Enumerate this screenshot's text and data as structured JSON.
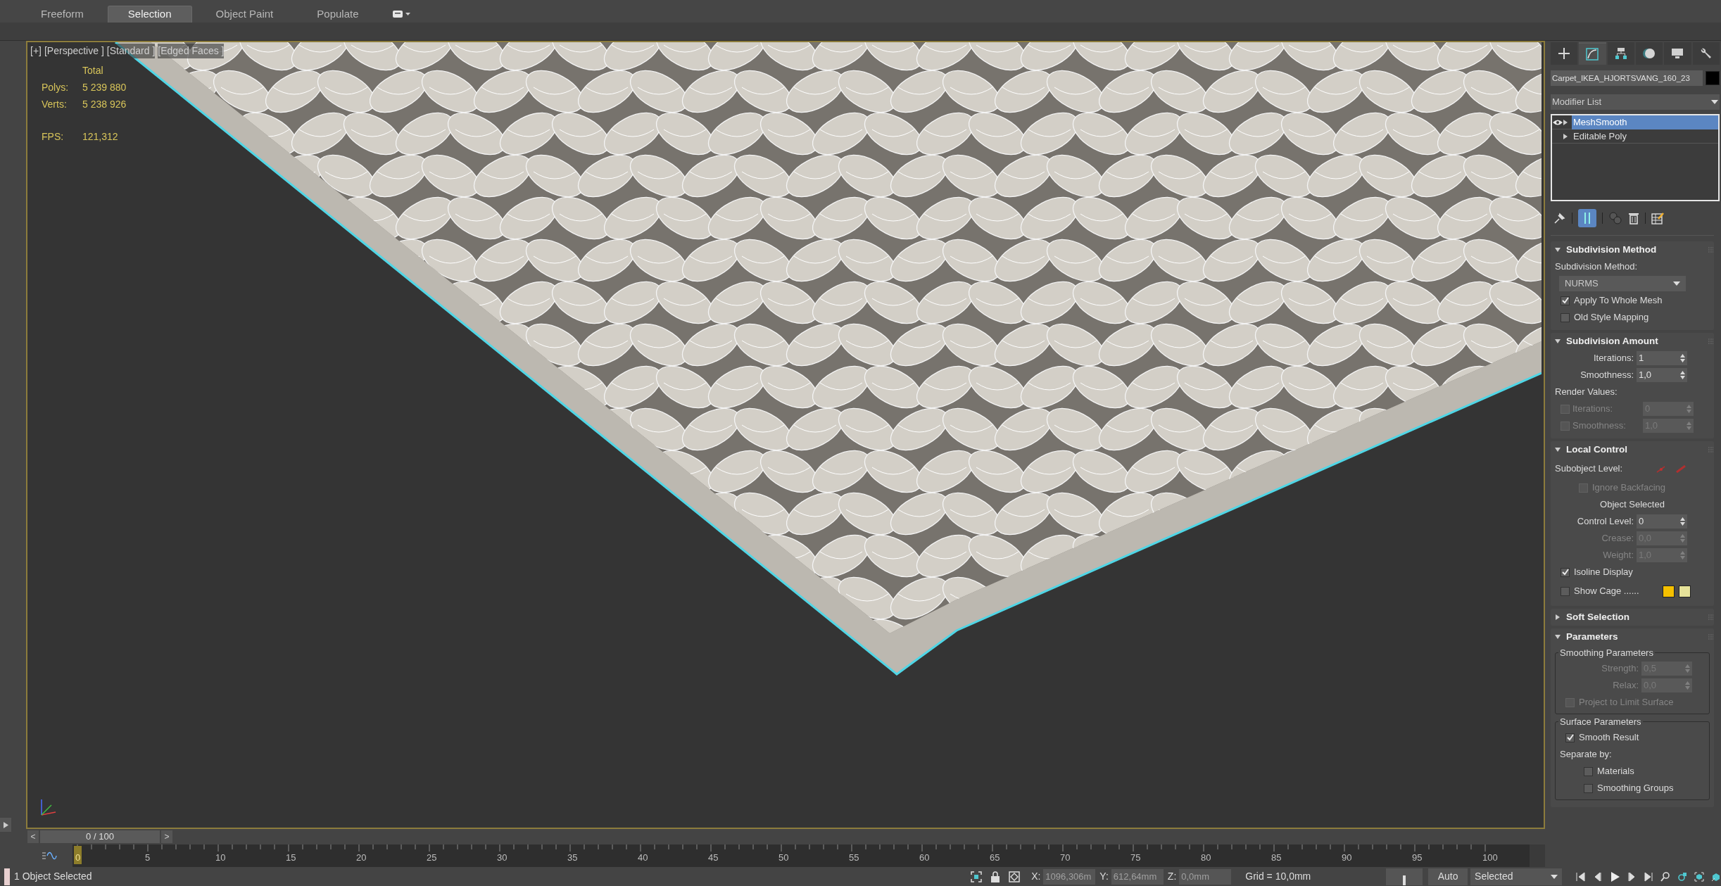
{
  "ribbon_tabs": [
    {
      "label": "Freeform",
      "selected": false
    },
    {
      "label": "Selection",
      "selected": true
    },
    {
      "label": "Object Paint",
      "selected": false
    },
    {
      "label": "Populate",
      "selected": false
    }
  ],
  "viewport": {
    "labels": [
      "[+]",
      "[Perspective ]",
      "[Standard ]",
      "[Edged Faces ]"
    ],
    "stats_header": "Total",
    "stats": [
      {
        "label": "Polys:",
        "value": "5 239 880"
      },
      {
        "label": "Verts:",
        "value": "5 238 926"
      }
    ],
    "fps": {
      "label": "FPS:",
      "value": "121,312"
    }
  },
  "command_panel": {
    "tabs": [
      {
        "kind": "create",
        "selected": false
      },
      {
        "kind": "modify",
        "selected": true
      },
      {
        "kind": "hierarchy",
        "selected": false
      },
      {
        "kind": "motion",
        "selected": false
      },
      {
        "kind": "display",
        "selected": false
      },
      {
        "kind": "utilities",
        "selected": false
      }
    ],
    "object_name": "Carpet_IKEA_HJORTSVANG_160_23",
    "modifier_list": "Modifier List",
    "stack": [
      {
        "label": "MeshSmooth",
        "selected": true,
        "visible": true
      },
      {
        "label": "Editable Poly",
        "selected": false,
        "visible": false
      }
    ],
    "rollouts": [
      {
        "title": "Subdivision Method",
        "expanded": true,
        "controls": [
          {
            "kind": "label",
            "text": "Subdivision Method:"
          },
          {
            "kind": "dropdown",
            "value": "NURMS"
          },
          {
            "kind": "checkbox",
            "label": "Apply To Whole Mesh",
            "checked": true,
            "disabled": false
          },
          {
            "kind": "checkbox",
            "label": "Old Style Mapping",
            "checked": false,
            "disabled": false
          }
        ]
      },
      {
        "title": "Subdivision Amount",
        "expanded": true,
        "controls": [
          {
            "kind": "spinner",
            "label": "Iterations:",
            "value": "1",
            "disabled": false
          },
          {
            "kind": "spinner",
            "label": "Smoothness:",
            "value": "1,0",
            "disabled": false
          },
          {
            "kind": "label",
            "text": "Render Values:"
          },
          {
            "kind": "checkspinner",
            "label": "Iterations:",
            "value": "0",
            "checked": false,
            "disabled": true
          },
          {
            "kind": "checkspinner",
            "label": "Smoothness:",
            "value": "1,0",
            "checked": false,
            "disabled": true
          }
        ]
      },
      {
        "title": "Local Control",
        "expanded": true,
        "controls": [
          {
            "kind": "subobject",
            "label": "Subobject Level:"
          },
          {
            "kind": "subcheckbox",
            "label": "Ignore Backfacing",
            "checked": false,
            "disabled": true
          },
          {
            "kind": "caption",
            "text": "Object Selected"
          },
          {
            "kind": "spinner",
            "label": "Control Level:",
            "value": "0",
            "disabled": false
          },
          {
            "kind": "spinner",
            "label": "Crease:",
            "value": "0,0",
            "disabled": true
          },
          {
            "kind": "spinner",
            "label": "Weight:",
            "value": "1,0",
            "disabled": true
          },
          {
            "kind": "checkbox",
            "label": "Isoline Display",
            "checked": true,
            "disabled": false
          },
          {
            "kind": "swatches",
            "label": "Show Cage ......",
            "checked": false,
            "disabled": false,
            "swatches": [
              {
                "color": "#f5c000"
              },
              {
                "color": "#e6e29a"
              }
            ]
          }
        ]
      },
      {
        "title": "Soft Selection",
        "expanded": false
      },
      {
        "title": "Parameters",
        "expanded": true,
        "controls": [
          {
            "kind": "group",
            "title": "Smoothing Parameters",
            "controls": [
              {
                "kind": "spinner",
                "label": "Strength:",
                "value": "0,5",
                "disabled": true
              },
              {
                "kind": "spinner",
                "label": "Relax:",
                "value": "0,0",
                "disabled": true
              },
              {
                "kind": "checkbox",
                "label": "Project to Limit Surface",
                "checked": false,
                "disabled": true
              }
            ]
          },
          {
            "kind": "group",
            "title": "Surface Parameters",
            "controls": [
              {
                "kind": "checkbox",
                "label": "Smooth Result",
                "checked": true,
                "disabled": false
              },
              {
                "kind": "label",
                "text": "Separate by:"
              },
              {
                "kind": "subcheckbox",
                "label": "Materials",
                "checked": false,
                "disabled": false
              },
              {
                "kind": "subcheckbox",
                "label": "Smoothing Groups",
                "checked": false,
                "disabled": false
              }
            ]
          }
        ]
      }
    ]
  },
  "time_slider": {
    "label": "0 / 100",
    "level": 0,
    "prev": "<",
    "next": ">"
  },
  "ruler_labels": [
    "0",
    "5",
    "10",
    "15",
    "20",
    "25",
    "30",
    "35",
    "40",
    "45",
    "50",
    "55",
    "60",
    "65",
    "70",
    "75",
    "80",
    "85",
    "90",
    "95",
    "100"
  ],
  "status_bar": {
    "message": "1 Object Selected",
    "coords": [
      {
        "label": "X:",
        "value": "1096,306m"
      },
      {
        "label": "Y:",
        "value": "612,64mm"
      },
      {
        "label": "Z:",
        "value": "0,0mm"
      }
    ],
    "grid": "Grid = 10,0mm",
    "auto_key": "Auto",
    "key_filter": "Selected"
  }
}
